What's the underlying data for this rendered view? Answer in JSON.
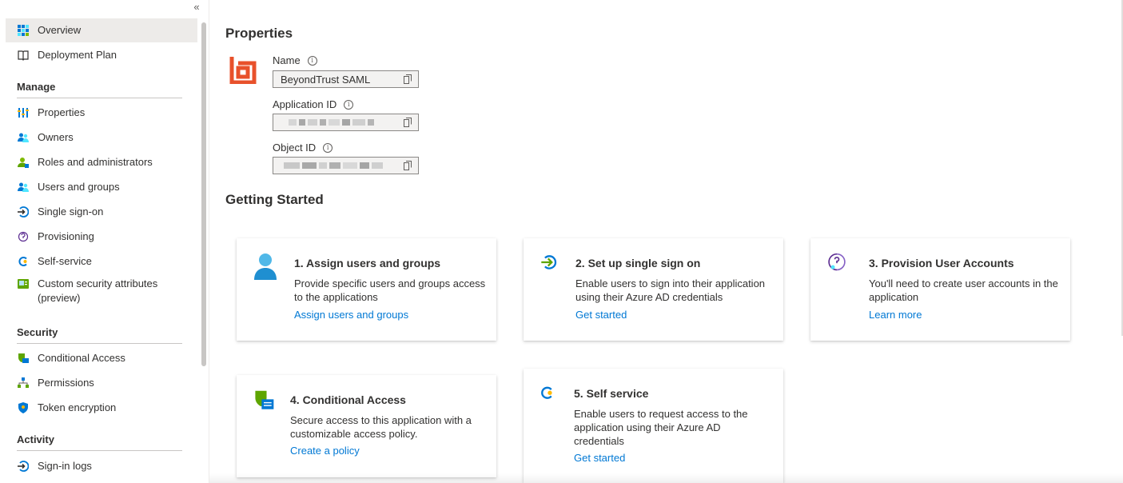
{
  "sidebar": {
    "collapse_glyph": "«",
    "items": [
      {
        "label": "Overview",
        "icon": "overview-icon"
      },
      {
        "label": "Deployment Plan",
        "icon": "book-icon"
      },
      {
        "label": "Properties",
        "icon": "properties-icon"
      },
      {
        "label": "Owners",
        "icon": "owners-icon"
      },
      {
        "label": "Roles and administrators",
        "icon": "roles-icon"
      },
      {
        "label": "Users and groups",
        "icon": "users-icon"
      },
      {
        "label": "Single sign-on",
        "icon": "sso-icon"
      },
      {
        "label": "Provisioning",
        "icon": "provisioning-icon"
      },
      {
        "label": "Self-service",
        "icon": "self-service-icon"
      },
      {
        "label": "Custom security attributes (preview)",
        "icon": "custom-attributes-icon"
      },
      {
        "label": "Conditional Access",
        "icon": "conditional-access-icon"
      },
      {
        "label": "Permissions",
        "icon": "permissions-icon"
      },
      {
        "label": "Token encryption",
        "icon": "shield-icon"
      },
      {
        "label": "Sign-in logs",
        "icon": "sign-in-logs-icon"
      }
    ],
    "sections": {
      "manage": "Manage",
      "security": "Security",
      "activity": "Activity"
    }
  },
  "properties": {
    "heading": "Properties",
    "name_label": "Name",
    "name_value": "BeyondTrust SAML",
    "app_id_label": "Application ID",
    "object_id_label": "Object ID"
  },
  "getting_started": {
    "heading": "Getting Started",
    "cards": [
      {
        "title": "1. Assign users and groups",
        "desc": "Provide specific users and groups access to the applications",
        "link": "Assign users and groups"
      },
      {
        "title": "2. Set up single sign on",
        "desc": "Enable users to sign into their application using their Azure AD credentials",
        "link": "Get started"
      },
      {
        "title": "3. Provision User Accounts",
        "desc": "You'll need to create user accounts in the application",
        "link": "Learn more"
      },
      {
        "title": "4. Conditional Access",
        "desc": "Secure access to this application with a customizable access policy.",
        "link": "Create a policy"
      },
      {
        "title": "5. Self service",
        "desc": "Enable users to request access to the application using their Azure AD credentials",
        "link": "Get started"
      }
    ]
  },
  "colors": {
    "accent": "#0078d4",
    "brand_logo": "#e8512b",
    "active_bg": "#edebe9"
  }
}
